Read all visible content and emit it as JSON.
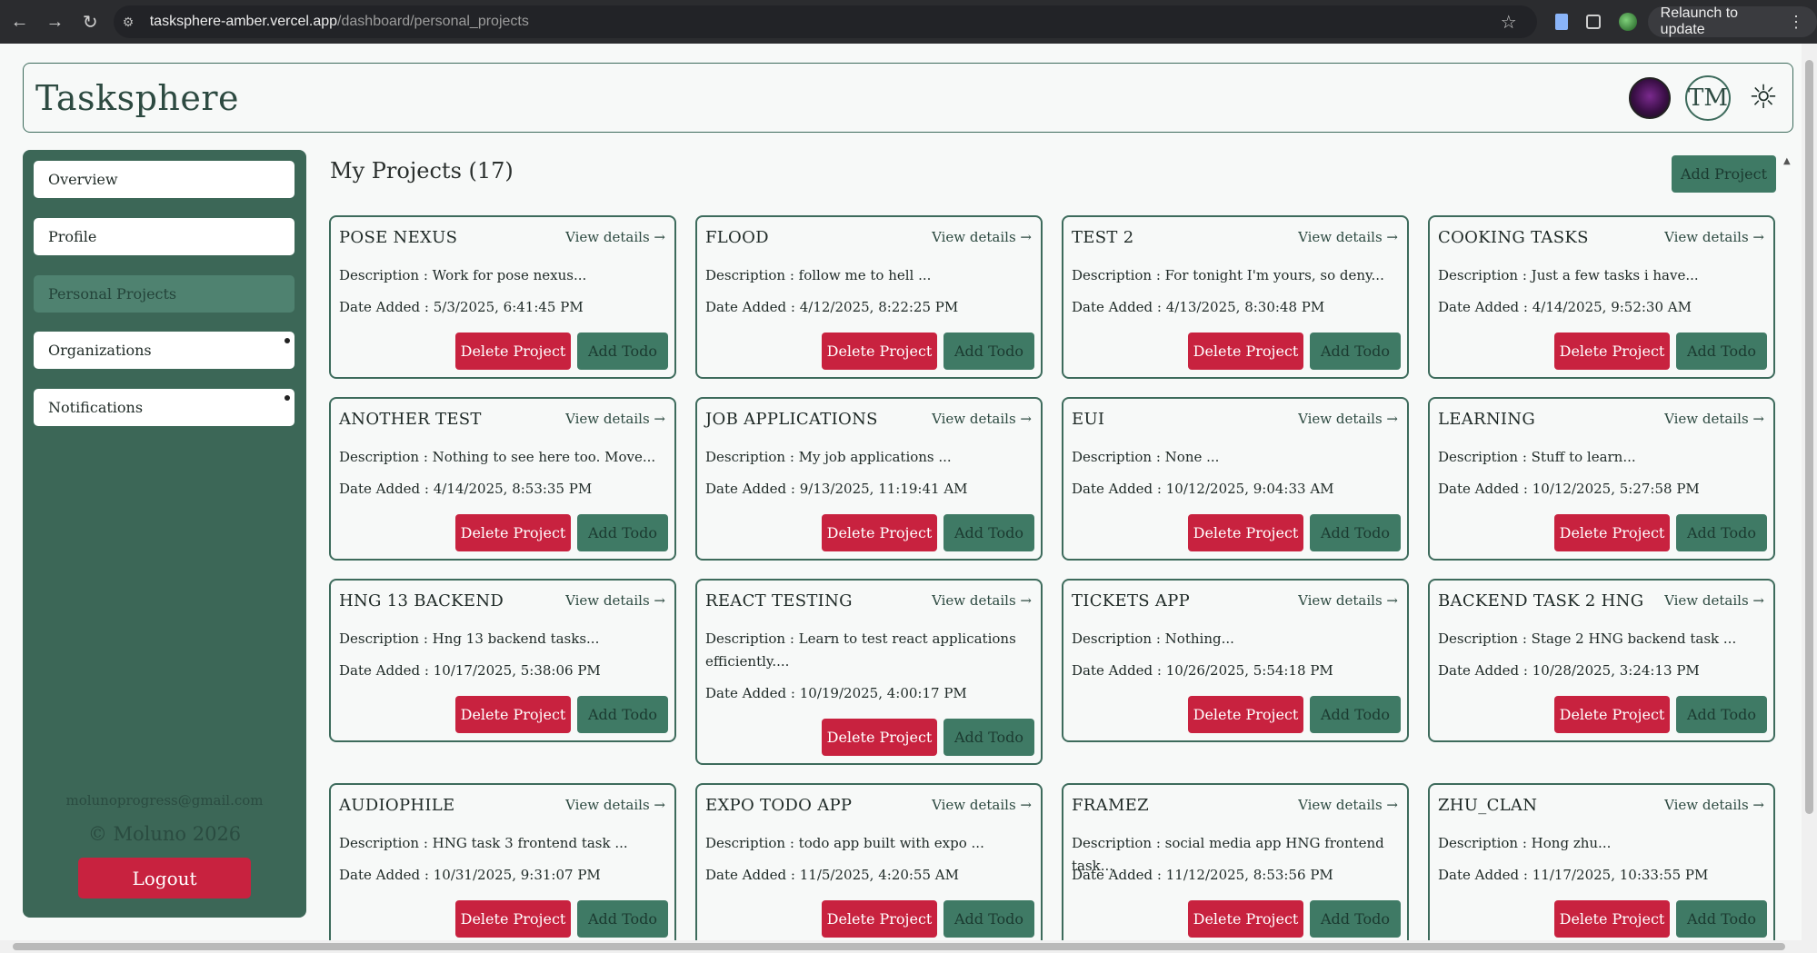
{
  "browser": {
    "url_host": "tasksphere-amber.vercel.app",
    "url_path": "/dashboard/personal_projects",
    "relaunch_label": "Relaunch to update"
  },
  "header": {
    "title": "Tasksphere",
    "avatar_initials": "TM"
  },
  "sidebar": {
    "items": [
      {
        "label": "Overview"
      },
      {
        "label": "Profile"
      },
      {
        "label": "Personal Projects"
      },
      {
        "label": "Organizations"
      },
      {
        "label": "Notifications"
      }
    ],
    "email": "molunoprogress@gmail.com",
    "copyright": "© Moluno 2026",
    "logout_label": "Logout"
  },
  "main": {
    "title": "My Projects (17)",
    "add_project_label": "Add Project",
    "view_details_label": "View details →",
    "delete_label": "Delete Project",
    "add_todo_label": "Add Todo",
    "projects": [
      {
        "name": "POSE NEXUS",
        "description": "Description : Work for pose nexus...",
        "date": "Date Added : 5/3/2025, 6:41:45 PM"
      },
      {
        "name": "FLOOD",
        "description": "Description : follow me to hell ...",
        "date": "Date Added : 4/12/2025, 8:22:25 PM"
      },
      {
        "name": "TEST 2",
        "description": "Description : For tonight I'm yours, so deny...",
        "date": "Date Added : 4/13/2025, 8:30:48 PM"
      },
      {
        "name": "COOKING TASKS",
        "description": "Description : Just a few tasks i have...",
        "date": "Date Added : 4/14/2025, 9:52:30 AM"
      },
      {
        "name": "ANOTHER TEST",
        "description": "Description : Nothing to see here too. Move...",
        "date": "Date Added : 4/14/2025, 8:53:35 PM"
      },
      {
        "name": "JOB APPLICATIONS",
        "description": "Description : My job applications ...",
        "date": "Date Added : 9/13/2025, 11:19:41 AM"
      },
      {
        "name": "EUI",
        "description": "Description : None ...",
        "date": "Date Added : 10/12/2025, 9:04:33 AM"
      },
      {
        "name": "LEARNING",
        "description": "Description : Stuff to learn...",
        "date": "Date Added : 10/12/2025, 5:27:58 PM"
      },
      {
        "name": "HNG 13 BACKEND",
        "description": "Description : Hng 13 backend tasks...",
        "date": "Date Added : 10/17/2025, 5:38:06 PM"
      },
      {
        "name": "REACT TESTING",
        "description": "Description : Learn to test react applications efficiently....",
        "date": "Date Added : 10/19/2025, 4:00:17 PM"
      },
      {
        "name": "TICKETS APP",
        "description": "Description : Nothing...",
        "date": "Date Added : 10/26/2025, 5:54:18 PM"
      },
      {
        "name": "BACKEND TASK 2 HNG",
        "description": "Description : Stage 2 HNG backend task ...",
        "date": "Date Added : 10/28/2025, 3:24:13 PM"
      },
      {
        "name": "AUDIOPHILE",
        "description": "Description : HNG task 3 frontend task ...",
        "date": "Date Added : 10/31/2025, 9:31:07 PM"
      },
      {
        "name": "EXPO TODO APP",
        "description": "Description : todo app built with expo ...",
        "date": "Date Added : 11/5/2025, 4:20:55 AM"
      },
      {
        "name": "FRAMEZ",
        "description": "Description : social media app HNG frontend task...",
        "date": "Date Added : 11/12/2025, 8:53:56 PM"
      },
      {
        "name": "ZHU_CLAN",
        "description": "Description : Hong zhu...",
        "date": "Date Added : 11/17/2025, 10:33:55 PM"
      }
    ]
  }
}
